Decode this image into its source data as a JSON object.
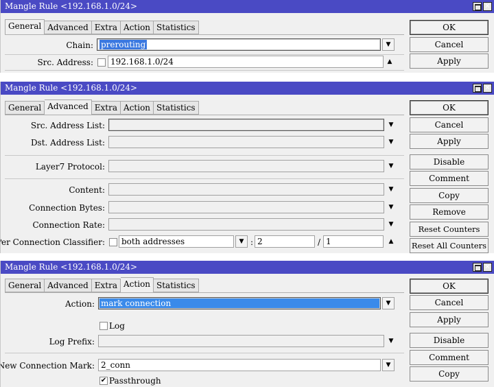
{
  "windows": [
    {
      "title": "Mangle Rule <192.168.1.0/24>",
      "tabs": [
        "General",
        "Advanced",
        "Extra",
        "Action",
        "Statistics"
      ],
      "active_tab": "General",
      "fields": {
        "chain_label": "Chain:",
        "chain_value": "prerouting",
        "src_address_label": "Src. Address:",
        "src_address_value": "192.168.1.0/24"
      },
      "buttons": [
        "OK",
        "Cancel",
        "Apply"
      ]
    },
    {
      "title": "Mangle Rule <192.168.1.0/24>",
      "tabs": [
        "General",
        "Advanced",
        "Extra",
        "Action",
        "Statistics"
      ],
      "active_tab": "Advanced",
      "fields": {
        "src_address_list_label": "Src. Address List:",
        "dst_address_list_label": "Dst. Address List:",
        "layer7_protocol_label": "Layer7 Protocol:",
        "content_label": "Content:",
        "connection_bytes_label": "Connection Bytes:",
        "connection_rate_label": "Connection Rate:",
        "pcc_label": "Per Connection Classifier:",
        "pcc_value": "both addresses",
        "pcc_colon": ":",
        "pcc_denominator": "2",
        "pcc_slash": "/",
        "pcc_remainder": "1"
      },
      "buttons": [
        "OK",
        "Cancel",
        "Apply",
        "Disable",
        "Comment",
        "Copy",
        "Remove",
        "Reset Counters",
        "Reset All Counters"
      ]
    },
    {
      "title": "Mangle Rule <192.168.1.0/24>",
      "tabs": [
        "General",
        "Advanced",
        "Extra",
        "Action",
        "Statistics"
      ],
      "active_tab": "Action",
      "fields": {
        "action_label": "Action:",
        "action_value": "mark connection",
        "log_label": "Log",
        "log_prefix_label": "Log Prefix:",
        "new_connection_mark_label": "New Connection Mark:",
        "new_connection_mark_value": "2_conn",
        "passthrough_label": "Passthrough"
      },
      "buttons": [
        "OK",
        "Cancel",
        "Apply",
        "Disable",
        "Comment",
        "Copy"
      ]
    }
  ],
  "icons": {
    "dropdown": "dropdown-toggle-icon",
    "arrow_down": "arrow-down-icon",
    "arrow_up": "arrow-up-icon",
    "maximize": "maximize-icon",
    "close": "close-icon"
  },
  "colors": {
    "titlebar": "#4a4ac4",
    "selection": "#3a8aea",
    "window_bg": "#f0f0f0"
  }
}
